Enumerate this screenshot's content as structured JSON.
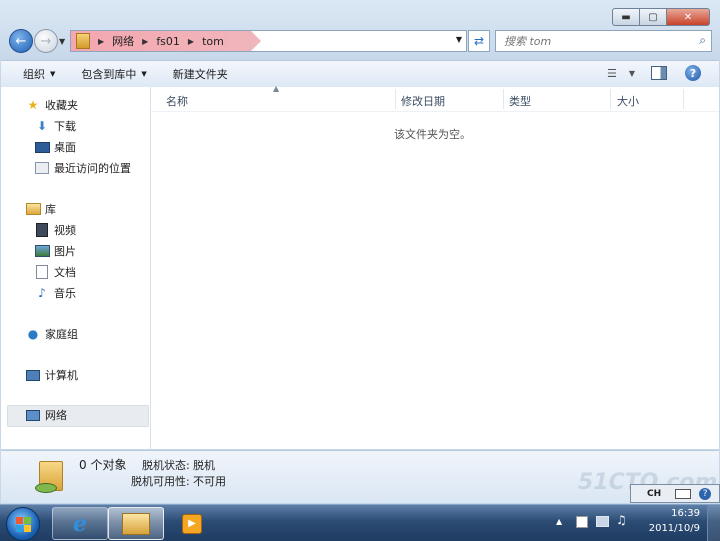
{
  "window": {
    "controls": {
      "minimize": "▬",
      "maximize": "▢",
      "close": "✕"
    }
  },
  "nav": {
    "back": "←",
    "forward": "→",
    "recent": "▼",
    "breadcrumbs": [
      "网络",
      "fs01",
      "tom"
    ],
    "refresh": "⇄",
    "search_placeholder": "搜索 tom"
  },
  "commands": {
    "organize": "组织",
    "include_in_library": "包含到库中",
    "new_folder": "新建文件夹"
  },
  "sidebar": {
    "favorites": {
      "label": "收藏夹",
      "items": [
        "下载",
        "桌面",
        "最近访问的位置"
      ]
    },
    "libraries": {
      "label": "库",
      "items": [
        "视频",
        "图片",
        "文档",
        "音乐"
      ]
    },
    "homegroup": "家庭组",
    "computer": "计算机",
    "network": "网络"
  },
  "file_list": {
    "columns": [
      "名称",
      "修改日期",
      "类型",
      "大小"
    ],
    "empty_message": "该文件夹为空。"
  },
  "details": {
    "count": "0 个对象",
    "offline_status_label": "脱机状态:",
    "offline_status_value": "脱机",
    "offline_availability_label": "脱机可用性:",
    "offline_availability_value": "不可用"
  },
  "taskbar": {
    "ime": "CH",
    "clock_time": "16:39",
    "clock_date": "2011/10/9",
    "watermark": "51CTO.com"
  }
}
